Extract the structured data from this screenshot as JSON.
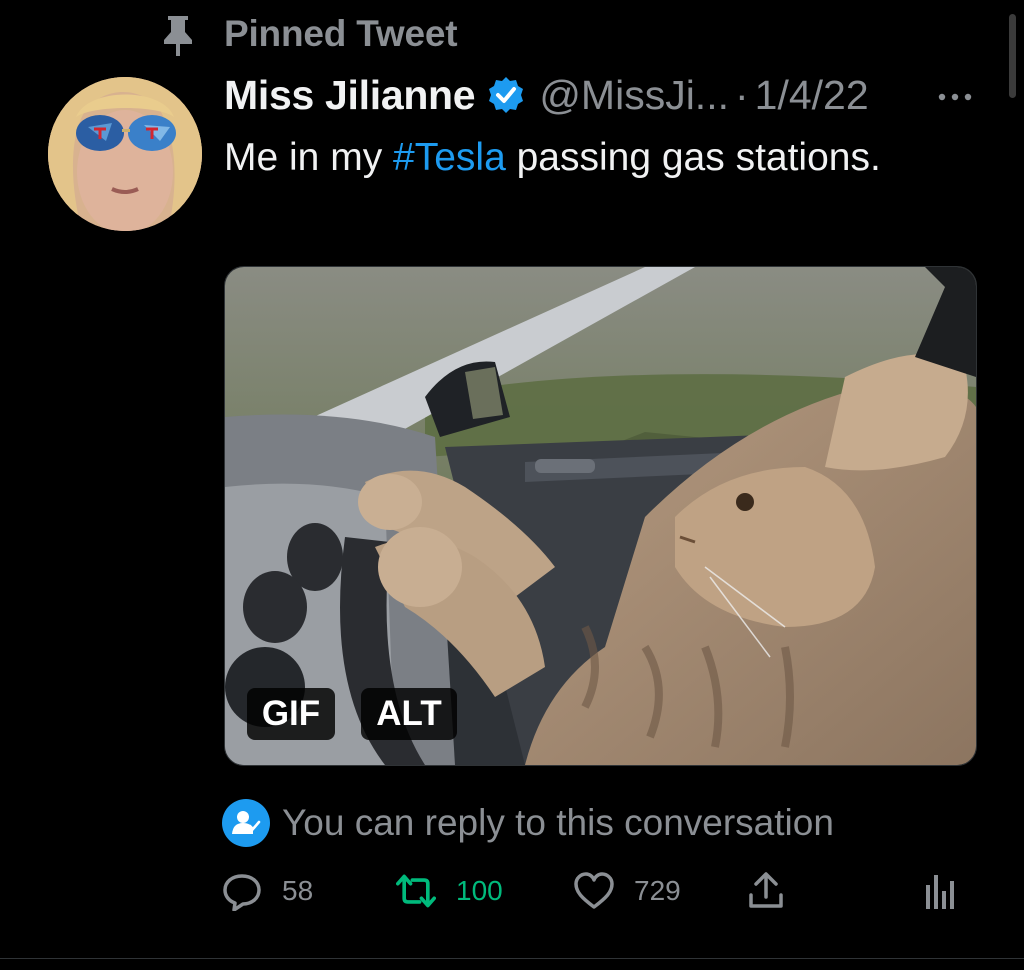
{
  "pinned": {
    "label": "Pinned Tweet",
    "icon": "pin-icon"
  },
  "tweet": {
    "author": {
      "display_name": "Miss Jilianne",
      "handle": "@MissJi...",
      "verified": true,
      "avatar_icon": "avatar"
    },
    "separator": "·",
    "date": "1/4/22",
    "text_before": "Me in my ",
    "hashtag": "#Tesla",
    "text_after": " passing gas stations.",
    "media": {
      "description": "",
      "badges": {
        "gif": "GIF",
        "alt": "ALT"
      }
    },
    "reply_notice": "You can reply to this conversation",
    "stats": {
      "replies": "58",
      "retweets": "100",
      "likes": "729"
    }
  },
  "colors": {
    "accent": "#1d9bf0",
    "retweet": "#00ba7c",
    "muted": "#8b8f94",
    "background": "#000000"
  }
}
